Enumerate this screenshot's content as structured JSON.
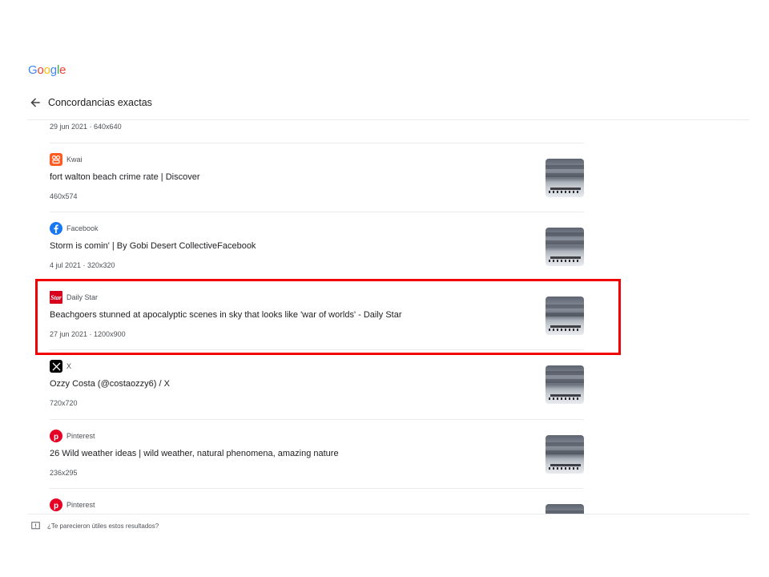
{
  "logo": {
    "letters": [
      "G",
      "o",
      "o",
      "g",
      "l",
      "e"
    ],
    "colors": [
      "#4285F4",
      "#EA4335",
      "#FBBC05",
      "#4285F4",
      "#34A853",
      "#EA4335"
    ]
  },
  "header": {
    "title": "Concordancias exactas"
  },
  "top_meta": "29 jun 2021 · 640x640",
  "results": [
    {
      "source": "Kwai",
      "icon": "kwai-icon",
      "title": "fort walton beach crime rate | Discover",
      "meta": "460x574"
    },
    {
      "source": "Facebook",
      "icon": "facebook-icon",
      "title": "Storm is comin' | By Gobi Desert CollectiveFacebook",
      "meta": "4 jul 2021 · 320x320"
    },
    {
      "source": "Daily Star",
      "icon": "daily-star-icon",
      "title": "Beachgoers stunned at apocalyptic scenes in sky that looks like 'war of worlds' - Daily Star",
      "meta": "27 jun 2021 · 1200x900",
      "highlighted": true
    },
    {
      "source": "X",
      "icon": "x-icon",
      "title": "Ozzy Costa (@costaozzy6) / X",
      "meta": "720x720"
    },
    {
      "source": "Pinterest",
      "icon": "pinterest-icon",
      "title": "26 Wild weather ideas | wild weather, natural phenomena, amazing nature",
      "meta": "236x295"
    },
    {
      "source": "Pinterest",
      "icon": "pinterest-icon",
      "title": "",
      "meta": ""
    }
  ],
  "footer": {
    "text": "¿Te parecieron útiles estos resultados?"
  },
  "colors": {
    "highlight": "#f20000",
    "kwai": "#ff5a1f",
    "facebook": "#1877f2",
    "daily_star": "#d6001c",
    "pinterest": "#e60023"
  }
}
